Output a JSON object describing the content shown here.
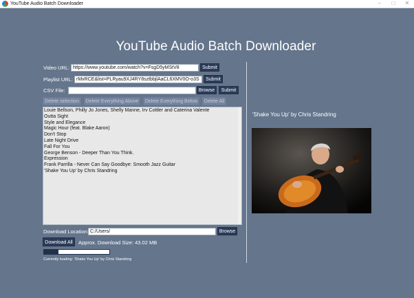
{
  "window": {
    "title": "YouTube Audio Batch Downloader",
    "minimize": "–",
    "maximize": "□",
    "close": "✕"
  },
  "heading": "YouTube Audio Batch Downloader",
  "video_url": {
    "label": "Video URL:",
    "value": "https://www.youtube.com/watch?v=FsgD5yMStV8",
    "submit": "Submit"
  },
  "playlist_url": {
    "label": "Playlist URL:",
    "value": "rMxRCE&list=PLRyau9XJ4RY8sztbbjlAaCL6XMV0O-o3S",
    "submit": "Submit"
  },
  "csv_file": {
    "label": "CSV File:",
    "value": "",
    "browse": "Browse",
    "submit": "Submit"
  },
  "actions": {
    "delete_selection": "Delete selection",
    "delete_above": "Delete Everything Above",
    "delete_below": "Delete Everything Below",
    "delete_all": "Delete All"
  },
  "tracks": [
    "Louie Bellson, Philly Jo Jones, Shelly Manne, Irv Cottler and Caterina Valente",
    "Outta Sight",
    "Style and Elegance",
    "Magic Hour (feat. Blake Aaron)",
    "Don't Stop",
    "Late Night Drive",
    "Fall For You",
    "George Benson - Deeper Than You Think.",
    "Expression",
    "Frank Parrilla - Never Can Say Goodbye: Smooth Jazz Guitar",
    "'Shake You Up' by Chris Standring"
  ],
  "download_location": {
    "label": "Download Location:",
    "value": "C:/Users/",
    "browse": "Browse"
  },
  "download_all": "Download All",
  "download_size": "Approx. Download Size: 43.02 MB",
  "progress": 0.22,
  "status": "Currently loading: 'Shake You Up' by Chris Standring",
  "now_playing": "'Shake You Up' by Chris Standring",
  "colors": {
    "background": "#64758c",
    "button": "#2b3b57",
    "button_disabled": "#7585a0"
  }
}
